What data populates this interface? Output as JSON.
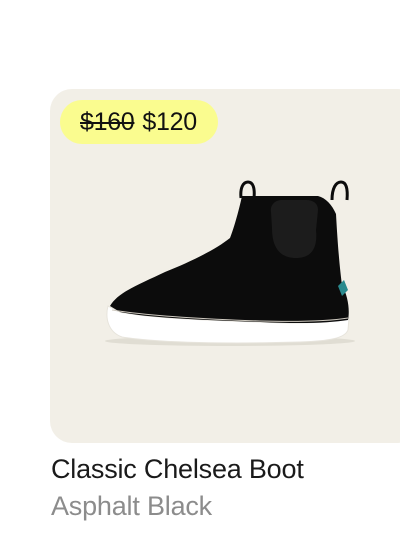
{
  "product": {
    "name": "Classic Chelsea Boot",
    "color": "Asphalt Black",
    "price_original": "$160",
    "price_sale": "$120",
    "image_alt": "chelsea-boot-icon"
  },
  "colors": {
    "tile_background": "#f2efe7",
    "badge_background": "#fafc8f",
    "title_text": "#1a1a1a",
    "subtitle_text": "#8c8c8c"
  }
}
